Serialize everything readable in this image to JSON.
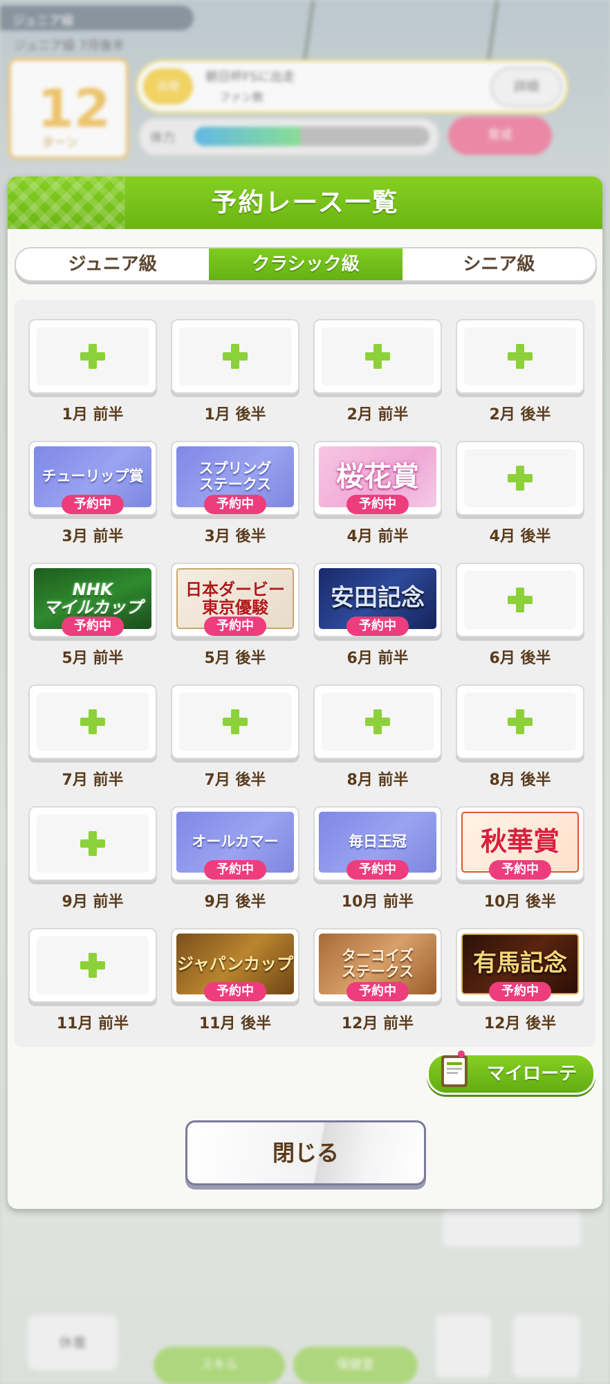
{
  "background": {
    "topbar_title": "ジュニア級",
    "topbar_sub": "ジュニア級 7月後半",
    "turn_number": "12",
    "turn_label": "ターン",
    "goal_tag": "目標",
    "goal_text": "朝日杯FSに出走",
    "goal_sub": "ファン数",
    "goal_button": "詳細",
    "energy_label": "体力",
    "energy_level": 0.45,
    "pink_button": "育成",
    "bottom_left": "休養",
    "bottom_green_1": "スキル",
    "bottom_green_2": "保健室"
  },
  "dialog": {
    "title": "予約レース一覧",
    "tabs": [
      {
        "label": "ジュニア級",
        "active": false
      },
      {
        "label": "クラシック級",
        "active": true
      },
      {
        "label": "シニア級",
        "active": false
      }
    ],
    "reserved_badge": "予約中",
    "my_rotation_label": "マイローテ",
    "close_label": "閉じる"
  },
  "slots": [
    {
      "label": "1月 前半",
      "race": null
    },
    {
      "label": "1月 後半",
      "race": null
    },
    {
      "label": "2月 前半",
      "race": null
    },
    {
      "label": "2月 後半",
      "race": null
    },
    {
      "label": "3月 前半",
      "race": "チューリップ賞",
      "style": "b-blue"
    },
    {
      "label": "3月 後半",
      "race": "スプリング\nステークス",
      "style": "b-blue"
    },
    {
      "label": "4月 前半",
      "race": "桜花賞",
      "style": "b-pink"
    },
    {
      "label": "4月 後半",
      "race": null
    },
    {
      "label": "5月 前半",
      "race": "NHK\nマイルカップ",
      "style": "b-green"
    },
    {
      "label": "5月 後半",
      "race": "日本ダービー\n東京優駿",
      "style": "b-cream"
    },
    {
      "label": "6月 前半",
      "race": "安田記念",
      "style": "b-navy"
    },
    {
      "label": "6月 後半",
      "race": null
    },
    {
      "label": "7月 前半",
      "race": null
    },
    {
      "label": "7月 後半",
      "race": null
    },
    {
      "label": "8月 前半",
      "race": null
    },
    {
      "label": "8月 後半",
      "race": null
    },
    {
      "label": "9月 前半",
      "race": null
    },
    {
      "label": "9月 後半",
      "race": "オールカマー",
      "style": "b-blue"
    },
    {
      "label": "10月 前半",
      "race": "毎日王冠",
      "style": "b-blue"
    },
    {
      "label": "10月 後半",
      "race": "秋華賞",
      "style": "b-autumn"
    },
    {
      "label": "11月 前半",
      "race": null
    },
    {
      "label": "11月 後半",
      "race": "ジャパンカップ",
      "style": "b-gold"
    },
    {
      "label": "12月 前半",
      "race": "ターコイズ\nステークス",
      "style": "b-bronze"
    },
    {
      "label": "12月 後半",
      "race": "有馬記念",
      "style": "b-dark"
    }
  ]
}
